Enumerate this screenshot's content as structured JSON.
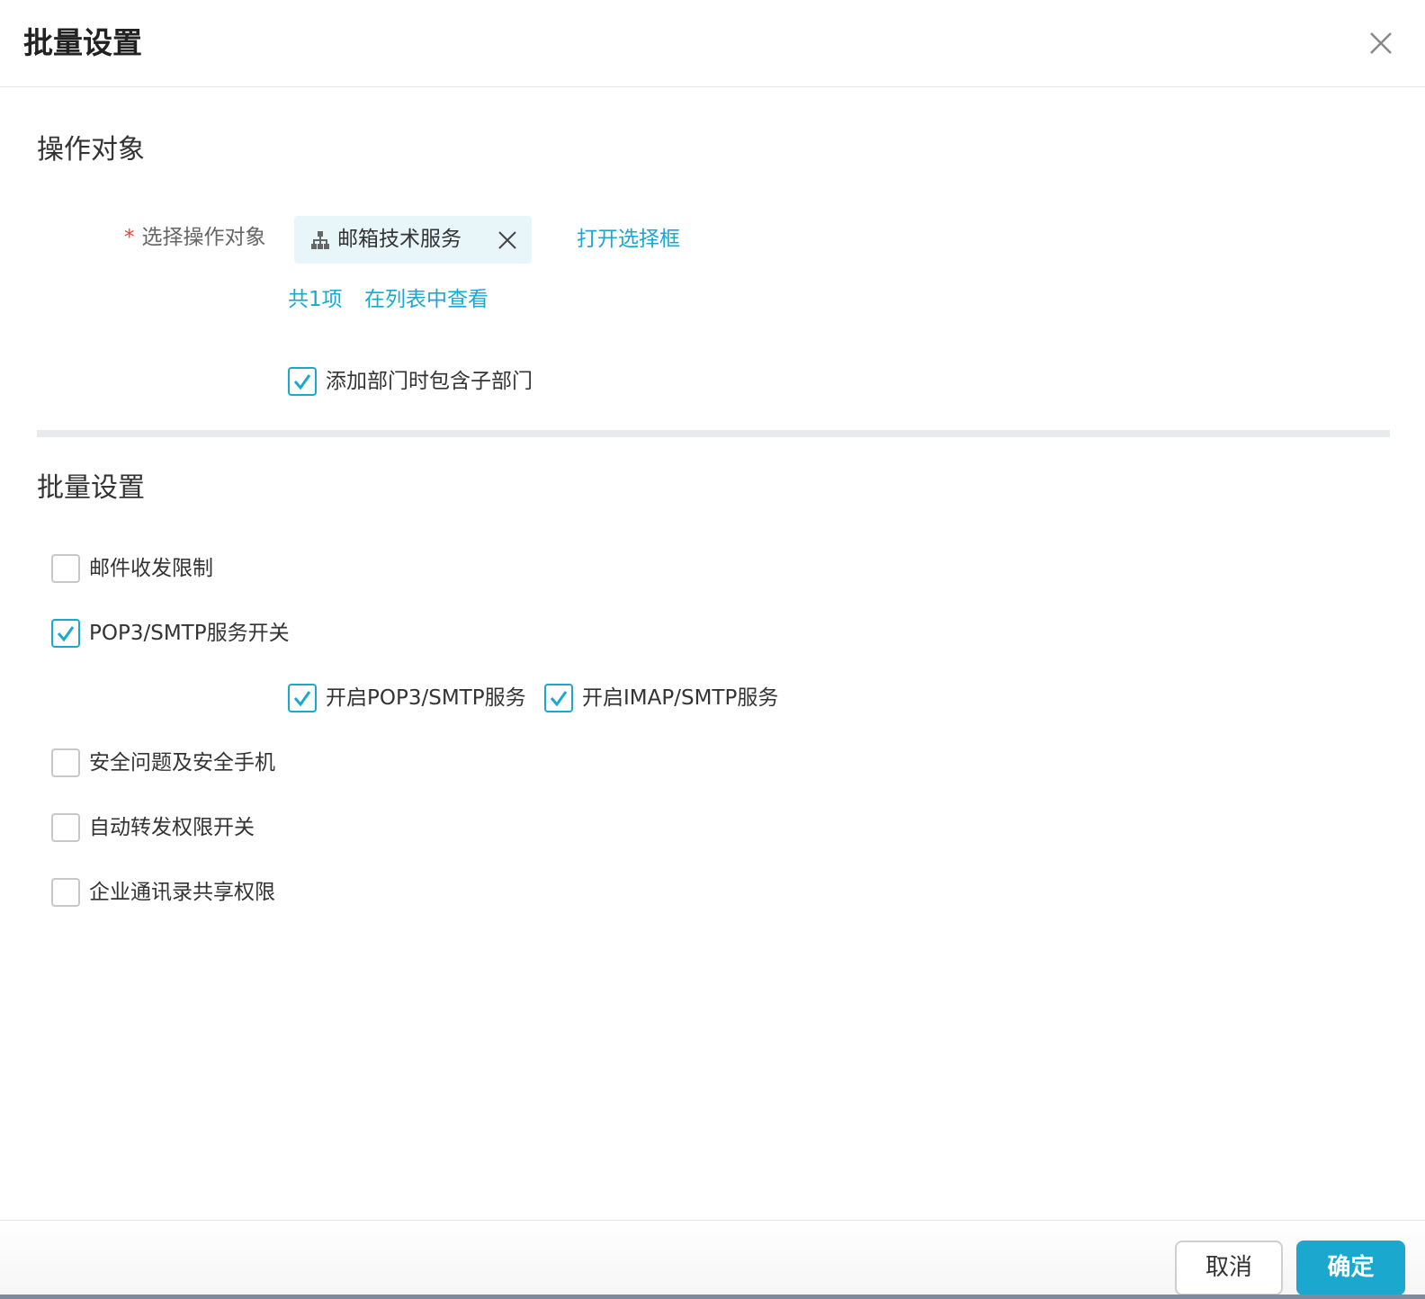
{
  "dialog": {
    "title": "批量设置"
  },
  "target_section": {
    "title": "操作对象",
    "label_required": "*",
    "label": "选择操作对象",
    "tag_text": "邮箱技术服务",
    "open_selector": "打开选择框",
    "count_text": "共1项",
    "view_in_list": "在列表中查看",
    "include_sub": {
      "label": "添加部门时包含子部门",
      "checked": true
    }
  },
  "batch_section": {
    "title": "批量设置",
    "options": [
      {
        "label": "邮件收发限制",
        "checked": false
      },
      {
        "label": "POP3/SMTP服务开关",
        "checked": true
      },
      {
        "label": "安全问题及安全手机",
        "checked": false
      },
      {
        "label": "自动转发权限开关",
        "checked": false
      },
      {
        "label": "企业通讯录共享权限",
        "checked": false
      }
    ],
    "sub_options": [
      {
        "label": "开启POP3/SMTP服务",
        "checked": true
      },
      {
        "label": "开启IMAP/SMTP服务",
        "checked": true
      }
    ]
  },
  "footer": {
    "cancel": "取消",
    "ok": "确定"
  },
  "colors": {
    "accent": "#1ba8cf",
    "required": "#f04134",
    "tag_bg": "#e8f6fa"
  }
}
